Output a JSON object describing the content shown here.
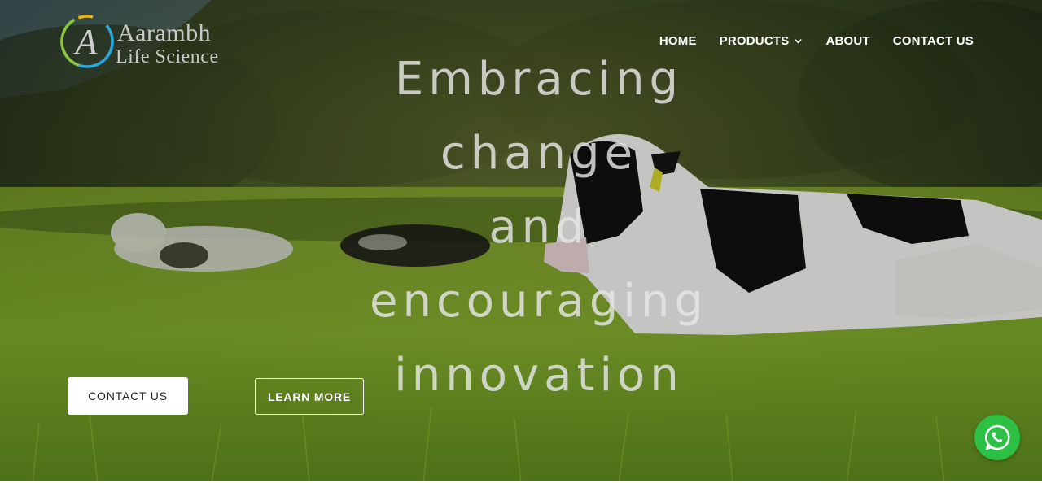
{
  "brand": {
    "name": "Aarambh",
    "tagline": "Life Science",
    "logo_icon": "brand-monogram-icon",
    "logo_colors": [
      "#f2b200",
      "#2aa8e0",
      "#8cc63f"
    ]
  },
  "nav": {
    "items": [
      {
        "label": "HOME"
      },
      {
        "label": "PRODUCTS",
        "icon": "chevron-down-icon"
      },
      {
        "label": "ABOUT"
      },
      {
        "label": "CONTACT US"
      }
    ]
  },
  "hero": {
    "headline_lines": [
      "Embracing",
      "change",
      "and",
      "encouraging",
      "innovation"
    ],
    "primary_button": "CONTACT US",
    "secondary_button": "LEARN MORE",
    "background_image": "cows-resting-in-green-pasture"
  },
  "floating": {
    "whatsapp_icon": "whatsapp-icon",
    "whatsapp_color": "#2cc045"
  }
}
